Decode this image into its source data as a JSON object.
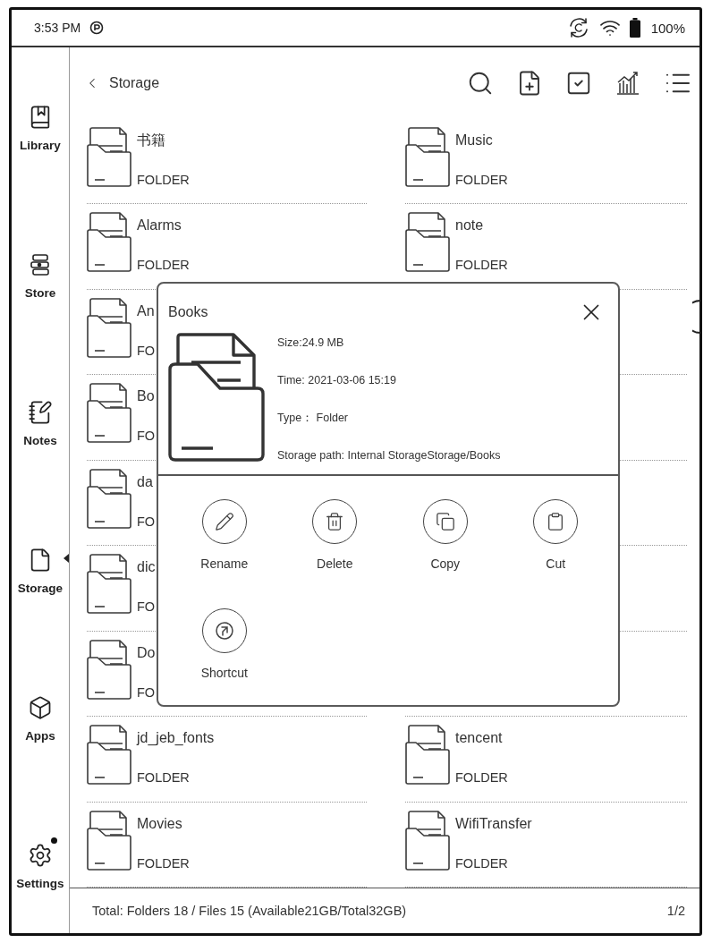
{
  "status_bar": {
    "time": "3:53 PM",
    "battery": "100%"
  },
  "sidebar": {
    "items": [
      {
        "label": "Library",
        "kind": "library",
        "selected": false,
        "notification": false
      },
      {
        "label": "Store",
        "kind": "store",
        "selected": false,
        "notification": false
      },
      {
        "label": "Notes",
        "kind": "notes",
        "selected": false,
        "notification": false
      },
      {
        "label": "Storage",
        "kind": "storage",
        "selected": true,
        "notification": false
      },
      {
        "label": "Apps",
        "kind": "apps",
        "selected": false,
        "notification": false
      },
      {
        "label": "Settings",
        "kind": "settings",
        "selected": false,
        "notification": true
      }
    ]
  },
  "toolbar": {
    "title": "Storage"
  },
  "grid": {
    "rows": [
      {
        "cells": [
          {
            "name": "书籍",
            "type": "FOLDER"
          },
          {
            "name": "Music",
            "type": "FOLDER"
          }
        ]
      },
      {
        "cells": [
          {
            "name": "Alarms",
            "type": "FOLDER"
          },
          {
            "name": "note",
            "type": "FOLDER"
          }
        ]
      },
      {
        "cells": [
          {
            "name": "An",
            "type": "FO"
          }
        ]
      },
      {
        "cells": [
          {
            "name": "Bo",
            "type": "FO"
          }
        ]
      },
      {
        "cells": [
          {
            "name": "da",
            "type": "FO"
          }
        ]
      },
      {
        "cells": [
          {
            "name": "dic",
            "type": "FO"
          }
        ]
      },
      {
        "cells": [
          {
            "name": "Do",
            "type": "FO"
          }
        ]
      },
      {
        "cells": [
          {
            "name": "jd_jeb_fonts",
            "type": "FOLDER"
          },
          {
            "name": "tencent",
            "type": "FOLDER"
          }
        ]
      },
      {
        "cells": [
          {
            "name": "Movies",
            "type": "FOLDER"
          },
          {
            "name": "WifiTransfer",
            "type": "FOLDER"
          }
        ]
      }
    ]
  },
  "dialog": {
    "title": "Books",
    "details": [
      "Size:24.9 MB",
      "Time: 2021-03-06 15:19",
      "Type： Folder",
      "Storage path: Internal StorageStorage/Books"
    ],
    "actions": [
      {
        "label": "Rename",
        "kind": "rename"
      },
      {
        "label": "Delete",
        "kind": "delete"
      },
      {
        "label": "Copy",
        "kind": "copy"
      },
      {
        "label": "Cut",
        "kind": "cut"
      },
      {
        "label": "Shortcut",
        "kind": "shortcut"
      }
    ]
  },
  "footer": {
    "summary": "Total: Folders 18 / Files 15 (Available21GB/Total32GB)",
    "page": "1/2"
  }
}
